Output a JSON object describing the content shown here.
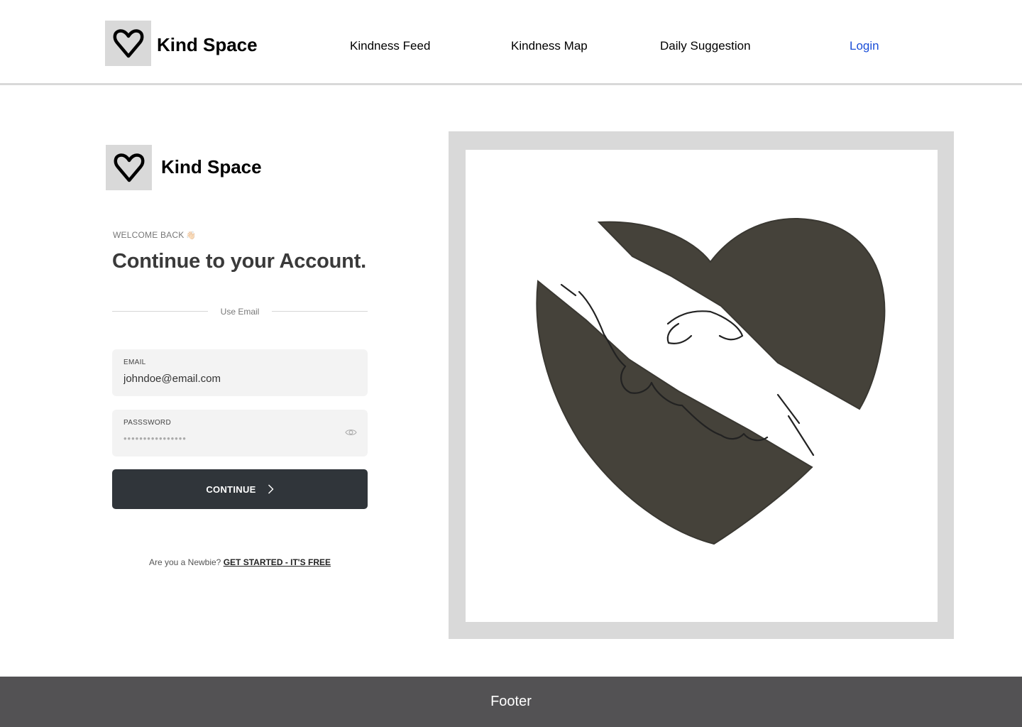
{
  "header": {
    "brand": "Kind Space",
    "logo_icon": "heart-icon",
    "nav": {
      "feed": "Kindness Feed",
      "map": "Kindness Map",
      "daily": "Daily Suggestion",
      "login": "Login"
    },
    "login_color": "#1a4ed8"
  },
  "form": {
    "brand": "Kind Space",
    "welcome": "WELCOME BACK",
    "welcome_emoji": "👋🏻",
    "heading": "Continue to your Account.",
    "divider": "Use Email",
    "email": {
      "label": "EMAIL",
      "value": "johndoe@email.com"
    },
    "password": {
      "label": "PASSSWORD",
      "value": "••••••••••••••••",
      "toggle_icon": "eye-icon"
    },
    "continue_label": "CONTINUE",
    "continue_icon": "chevron-right-icon",
    "newbie_prompt": "Are you a Newbie?",
    "newbie_link": "GET STARTED - IT'S FREE"
  },
  "illustration": {
    "subject": "handshake-heart-illustration"
  },
  "footer": {
    "text": "Footer",
    "background": "#535254"
  },
  "colors": {
    "button": "#30353a",
    "placeholder_gray": "#d9d9d9",
    "field_bg": "#f3f3f3"
  }
}
